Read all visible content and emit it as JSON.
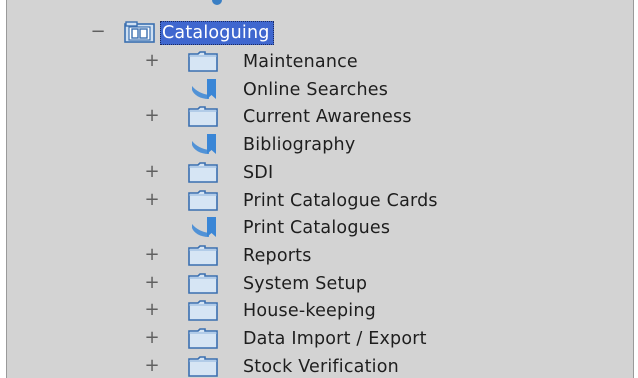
{
  "tree": {
    "root": {
      "label": "Cataloguing",
      "expander": "−",
      "icon": "library-folder-icon",
      "selected": true
    },
    "children": [
      {
        "label": "Maintenance",
        "expander": "+",
        "icon": "folder-icon"
      },
      {
        "label": "Online Searches",
        "expander": "",
        "icon": "bookmark-document-icon"
      },
      {
        "label": "Current Awareness",
        "expander": "+",
        "icon": "folder-icon"
      },
      {
        "label": "Bibliography",
        "expander": "",
        "icon": "bookmark-document-icon"
      },
      {
        "label": "SDI",
        "expander": "+",
        "icon": "folder-icon"
      },
      {
        "label": "Print Catalogue Cards",
        "expander": "+",
        "icon": "folder-icon"
      },
      {
        "label": "Print Catalogues",
        "expander": "",
        "icon": "bookmark-document-icon"
      },
      {
        "label": "Reports",
        "expander": "+",
        "icon": "folder-icon"
      },
      {
        "label": "System Setup",
        "expander": "+",
        "icon": "folder-icon"
      },
      {
        "label": "House-keeping",
        "expander": "+",
        "icon": "folder-icon"
      },
      {
        "label": "Data Import / Export",
        "expander": "+",
        "icon": "folder-icon"
      },
      {
        "label": "Stock Verification",
        "expander": "+",
        "icon": "folder-icon"
      }
    ]
  },
  "colors": {
    "background": "#d3d3d3",
    "selection": "#3f67cf",
    "folder_fill": "#d6e5f4",
    "folder_border": "#3a6fb0",
    "doc_blue": "#3a86d6",
    "text": "#1e1e1e"
  }
}
